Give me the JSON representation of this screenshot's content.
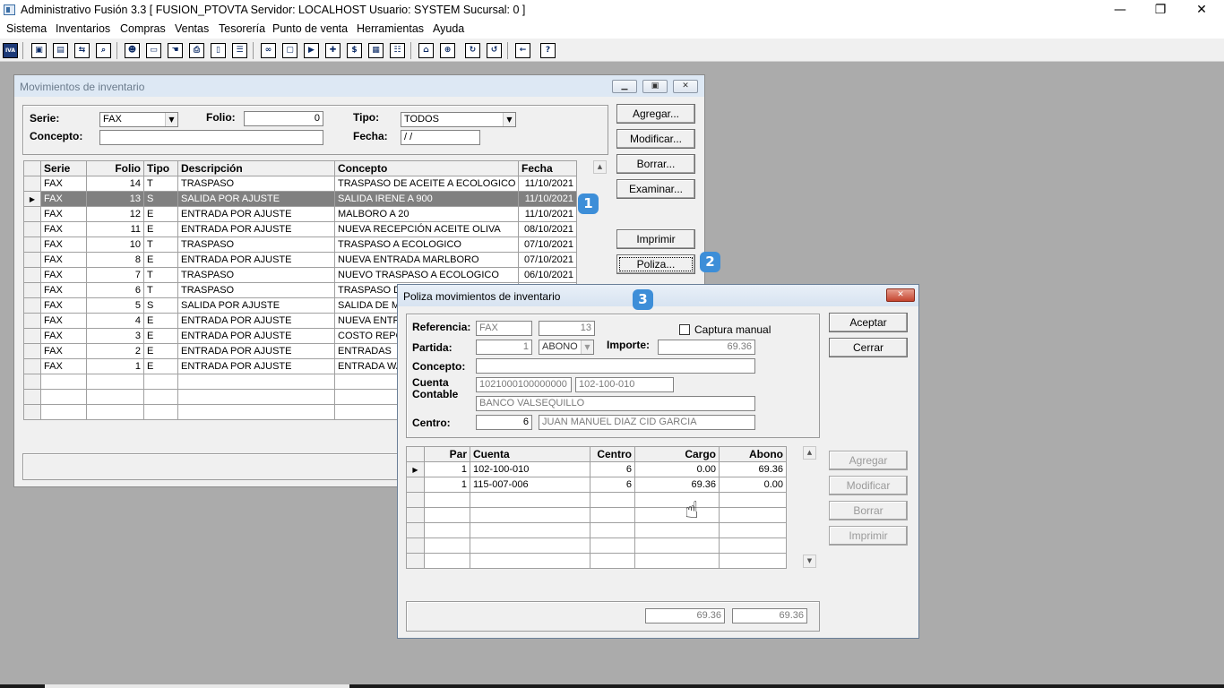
{
  "app": {
    "title": "Administrativo Fusión 3.3 [ FUSION_PTOVTA   Servidor: LOCALHOST   Usuario: SYSTEM    Sucursal: 0 ]",
    "minimize": "—",
    "restore": "❐",
    "close": "✕"
  },
  "menu": [
    "Sistema",
    "Inventarios",
    "Compras",
    "Ventas",
    "Tesorería",
    "Punto de venta",
    "Herramientas",
    "Ayuda"
  ],
  "toolbar_icons": [
    "iva-icon",
    "catalog-icon",
    "clipboard-icon",
    "transfer-icon",
    "search-doc-icon",
    "user-icon",
    "folder-icon",
    "hand-doc-icon",
    "printer-doc-icon",
    "document-icon",
    "list-icon",
    "binoculars-icon",
    "box-icon",
    "truck-icon",
    "add-icon",
    "dollar-icon",
    "report-icon",
    "table-icon",
    "home-icon",
    "zoom-icon",
    "refresh-icon",
    "undo-icon",
    "exit-icon",
    "help-icon"
  ],
  "movimientos": {
    "title": "Movimientos de inventario",
    "serie_label": "Serie:",
    "serie_value": "FAX",
    "folio_label": "Folio:",
    "folio_value": "0",
    "tipo_label": "Tipo:",
    "tipo_value": "TODOS",
    "concepto_label": "Concepto:",
    "concepto_value": "",
    "fecha_label": "Fecha:",
    "fecha_value": " / /",
    "buttons": {
      "agregar": "Agregar...",
      "modificar": "Modificar...",
      "borrar": "Borrar...",
      "examinar": "Examinar...",
      "imprimir": "Imprimir",
      "poliza": "Poliza..."
    },
    "columns": [
      "Serie",
      "Folio",
      "Tipo",
      "Descripción",
      "Concepto",
      "Fecha"
    ],
    "rows": [
      {
        "serie": "FAX",
        "folio": "14",
        "tipo": "T",
        "descripcion": "TRASPASO",
        "concepto": "TRASPASO DE ACEITE A ECOLOGICO",
        "fecha": "11/10/2021"
      },
      {
        "serie": "FAX",
        "folio": "13",
        "tipo": "S",
        "descripcion": "SALIDA POR AJUSTE",
        "concepto": "SALIDA IRENE A 900",
        "fecha": "11/10/2021"
      },
      {
        "serie": "FAX",
        "folio": "12",
        "tipo": "E",
        "descripcion": "ENTRADA POR AJUSTE",
        "concepto": "MALBORO A 20",
        "fecha": "11/10/2021"
      },
      {
        "serie": "FAX",
        "folio": "11",
        "tipo": "E",
        "descripcion": "ENTRADA POR AJUSTE",
        "concepto": "NUEVA RECEPCIÓN ACEITE OLIVA",
        "fecha": "08/10/2021"
      },
      {
        "serie": "FAX",
        "folio": "10",
        "tipo": "T",
        "descripcion": "TRASPASO",
        "concepto": "TRASPASO A ECOLOGICO",
        "fecha": "07/10/2021"
      },
      {
        "serie": "FAX",
        "folio": "8",
        "tipo": "E",
        "descripcion": "ENTRADA POR AJUSTE",
        "concepto": "NUEVA ENTRADA MARLBORO",
        "fecha": "07/10/2021"
      },
      {
        "serie": "FAX",
        "folio": "7",
        "tipo": "T",
        "descripcion": "TRASPASO",
        "concepto": "NUEVO TRASPASO A ECOLOGICO",
        "fecha": "06/10/2021"
      },
      {
        "serie": "FAX",
        "folio": "6",
        "tipo": "T",
        "descripcion": "TRASPASO",
        "concepto": "TRASPASO DE",
        "fecha": ""
      },
      {
        "serie": "FAX",
        "folio": "5",
        "tipo": "S",
        "descripcion": "SALIDA POR AJUSTE",
        "concepto": "SALIDA DE ME",
        "fecha": ""
      },
      {
        "serie": "FAX",
        "folio": "4",
        "tipo": "E",
        "descripcion": "ENTRADA POR AJUSTE",
        "concepto": "NUEVA ENTRA",
        "fecha": ""
      },
      {
        "serie": "FAX",
        "folio": "3",
        "tipo": "E",
        "descripcion": "ENTRADA POR AJUSTE",
        "concepto": "COSTO REPOS",
        "fecha": ""
      },
      {
        "serie": "FAX",
        "folio": "2",
        "tipo": "E",
        "descripcion": "ENTRADA POR AJUSTE",
        "concepto": "ENTRADAS",
        "fecha": ""
      },
      {
        "serie": "FAX",
        "folio": "1",
        "tipo": "E",
        "descripcion": "ENTRADA POR AJUSTE",
        "concepto": "ENTRADA WA",
        "fecha": ""
      }
    ]
  },
  "poliza": {
    "title": "Poliza movimientos de inventario",
    "referencia_label": "Referencia:",
    "referencia_serie": "FAX",
    "referencia_folio": "13",
    "captura_manual_label": "Captura manual",
    "partida_label": "Partida:",
    "partida_value": "1",
    "partida_tipo": "ABONO",
    "importe_label": "Importe:",
    "importe_value": "69.36",
    "concepto_label": "Concepto:",
    "concepto_value": "",
    "cuenta_label_1": "Cuenta",
    "cuenta_label_2": "Contable",
    "cuenta_numero": "1021000100000000",
    "cuenta_codigo": "102-100-010",
    "cuenta_nombre": "BANCO VALSEQUILLO",
    "centro_label": "Centro:",
    "centro_value": "6",
    "centro_nombre": "JUAN MANUEL DIAZ CID GARCIA",
    "buttons": {
      "aceptar": "Aceptar",
      "cerrar": "Cerrar",
      "agregar": "Agregar",
      "modificar": "Modificar",
      "borrar": "Borrar",
      "imprimir": "Imprimir"
    },
    "columns": [
      "Par",
      "Cuenta",
      "Centro",
      "Cargo",
      "Abono"
    ],
    "rows": [
      {
        "par": "1",
        "cuenta": "102-100-010",
        "centro": "6",
        "cargo": "0.00",
        "abono": "69.36"
      },
      {
        "par": "1",
        "cuenta": "115-007-006",
        "centro": "6",
        "cargo": "69.36",
        "abono": "0.00"
      }
    ],
    "total_cargo": "69.36",
    "total_abono": "69.36"
  },
  "badges": [
    "1",
    "2",
    "3"
  ]
}
